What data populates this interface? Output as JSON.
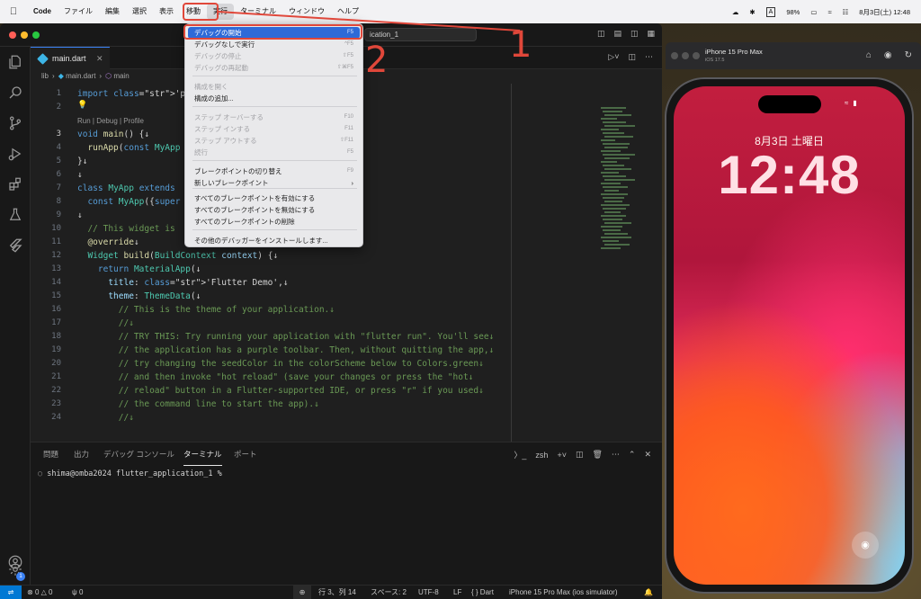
{
  "menubar": {
    "app_name": "Code",
    "menus": [
      "ファイル",
      "編集",
      "選択",
      "表示",
      "移動",
      "実行",
      "ターミナル",
      "ウィンドウ",
      "ヘルプ"
    ],
    "battery": "98%",
    "input_mode": "A",
    "datetime": "8月3日(土) 12:48"
  },
  "vscode": {
    "command_center": "ication_1",
    "tab": {
      "label": "main.dart"
    },
    "breadcrumb": {
      "folder": "lib",
      "file": "main.dart",
      "symbol": "main"
    },
    "codelens": "Run | Debug | Profile",
    "lines": [
      {
        "n": "1",
        "text": "import 'package:flut"
      },
      {
        "n": "2",
        "text": ""
      },
      {
        "n": "3",
        "text": "void main() {↓"
      },
      {
        "n": "4",
        "text": "  runApp(const MyApp"
      },
      {
        "n": "5",
        "text": "}↓"
      },
      {
        "n": "6",
        "text": "↓"
      },
      {
        "n": "7",
        "text": "class MyApp extends"
      },
      {
        "n": "8",
        "text": "  const MyApp({super"
      },
      {
        "n": "9",
        "text": "↓"
      },
      {
        "n": "10",
        "text": "  // This widget is"
      },
      {
        "n": "11",
        "text": "  @override↓"
      },
      {
        "n": "12",
        "text": "  Widget build(BuildContext context) {↓"
      },
      {
        "n": "13",
        "text": "    return MaterialApp(↓"
      },
      {
        "n": "14",
        "text": "      title: 'Flutter Demo',↓"
      },
      {
        "n": "15",
        "text": "      theme: ThemeData(↓"
      },
      {
        "n": "16",
        "text": "        // This is the theme of your application.↓"
      },
      {
        "n": "17",
        "text": "        //↓"
      },
      {
        "n": "18",
        "text": "        // TRY THIS: Try running your application with \"flutter run\". You'll see↓"
      },
      {
        "n": "19",
        "text": "        // the application has a purple toolbar. Then, without quitting the app,↓"
      },
      {
        "n": "20",
        "text": "        // try changing the seedColor in the colorScheme below to Colors.green↓"
      },
      {
        "n": "21",
        "text": "        // and then invoke \"hot reload\" (save your changes or press the \"hot↓"
      },
      {
        "n": "22",
        "text": "        // reload\" button in a Flutter-supported IDE, or press \"r\" if you used↓"
      },
      {
        "n": "23",
        "text": "        // the command line to start the app).↓"
      },
      {
        "n": "24",
        "text": "        //↓"
      }
    ],
    "panel": {
      "tabs": [
        "問題",
        "出力",
        "デバッグ コンソール",
        "ターミナル",
        "ポート"
      ],
      "active_tab": "ターミナル",
      "shell": "zsh",
      "prompt": "shima@omba2024 flutter_application_1 %"
    },
    "status": {
      "errors": "0",
      "warnings": "0",
      "ports": "0",
      "position": "行 3、列 14",
      "spaces": "スペース: 2",
      "encoding": "UTF-8",
      "eol": "LF",
      "language": "Dart",
      "device": "iPhone 15 Pro Max (ios simulator)",
      "notification_count": "1"
    }
  },
  "run_menu": {
    "items": [
      {
        "label": "デバッグの開始",
        "shortcut": "F5",
        "state": "highlight"
      },
      {
        "label": "デバッグなしで実行",
        "shortcut": "^F5",
        "state": "enabled"
      },
      {
        "label": "デバッグの停止",
        "shortcut": "⇧F5",
        "state": "disabled"
      },
      {
        "label": "デバッグの再起動",
        "shortcut": "⇧⌘F5",
        "state": "disabled"
      },
      {
        "label": "構成を開く",
        "shortcut": "",
        "state": "disabled"
      },
      {
        "label": "構成の追加...",
        "shortcut": "",
        "state": "enabled"
      },
      {
        "label": "ステップ オーバーする",
        "shortcut": "F10",
        "state": "disabled"
      },
      {
        "label": "ステップ インする",
        "shortcut": "F11",
        "state": "disabled"
      },
      {
        "label": "ステップ アウトする",
        "shortcut": "⇧F11",
        "state": "disabled"
      },
      {
        "label": "続行",
        "shortcut": "F5",
        "state": "disabled"
      },
      {
        "label": "ブレークポイントの切り替え",
        "shortcut": "F9",
        "state": "enabled"
      },
      {
        "label": "新しいブレークポイント",
        "shortcut": "",
        "state": "submenu"
      },
      {
        "label": "すべてのブレークポイントを有効にする",
        "shortcut": "",
        "state": "enabled"
      },
      {
        "label": "すべてのブレークポイントを無効にする",
        "shortcut": "",
        "state": "enabled"
      },
      {
        "label": "すべてのブレークポイントの削除",
        "shortcut": "",
        "state": "enabled"
      },
      {
        "label": "その他のデバッガーをインストールします...",
        "shortcut": "",
        "state": "enabled"
      }
    ]
  },
  "annotations": {
    "step1": "1",
    "step2": "2",
    "color": "#e0473a"
  },
  "simulator": {
    "title": "iPhone 15 Pro Max",
    "subtitle": "iOS 17.5",
    "lock_date": "8月3日 土曜日",
    "lock_time": "12:48"
  },
  "colors": {
    "accent": "#0078d4",
    "menu_highlight": "#2e6ad8"
  }
}
